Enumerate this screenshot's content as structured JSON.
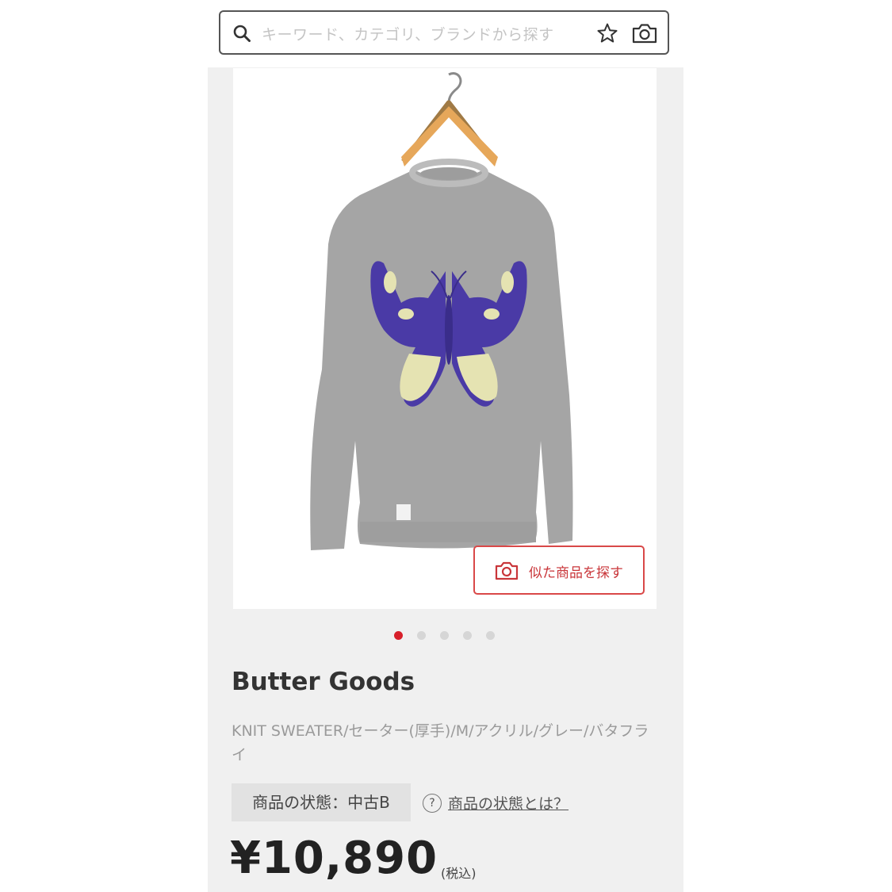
{
  "search": {
    "placeholder": "キーワード、カテゴリ、ブランドから探す",
    "icons": [
      "search-icon",
      "star-icon",
      "camera-icon"
    ]
  },
  "product_image": {
    "similar_button_label": "似た商品を探す",
    "carousel_total": 5,
    "carousel_active": 1
  },
  "product": {
    "brand": "Butter Goods",
    "description": "KNIT SWEATER/セーター(厚手)/M/アクリル/グレー/バタフライ",
    "condition_label": "商品の状態：中古B",
    "condition_help": "商品の状態とは？",
    "help_icon_glyph": "?",
    "price": "¥10,890",
    "tax_note": "(税込)"
  },
  "colors": {
    "accent_red": "#d71f2a",
    "dot_inactive": "#d6d6d6"
  }
}
